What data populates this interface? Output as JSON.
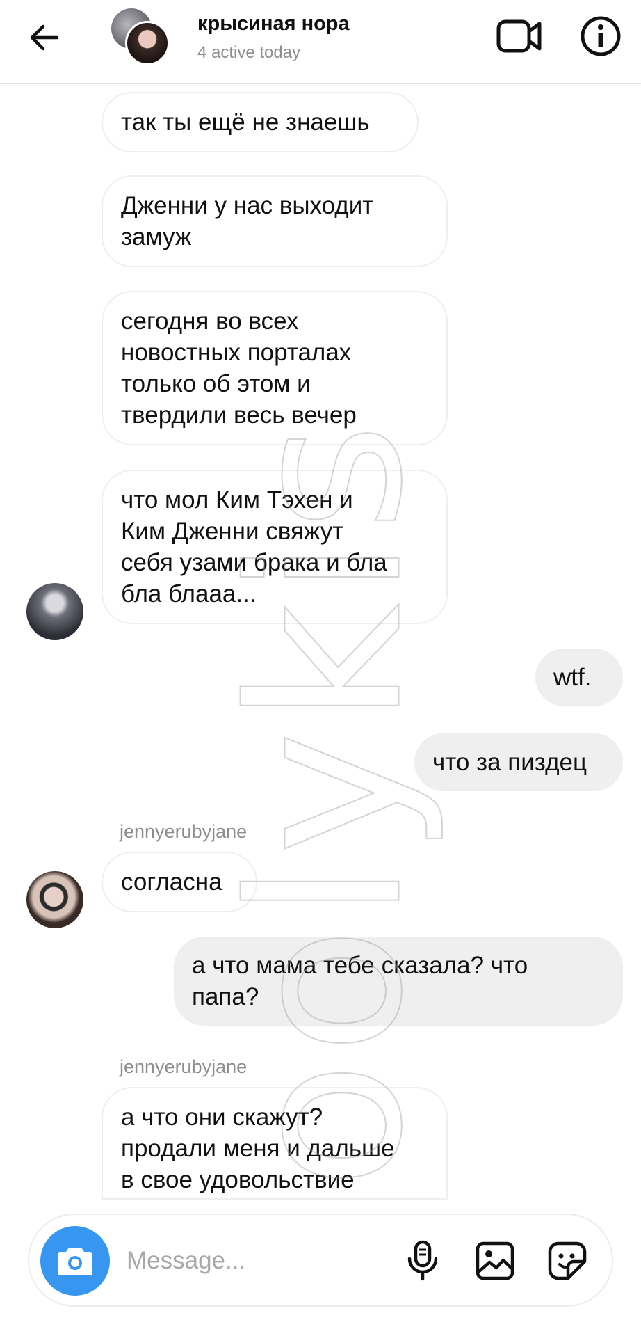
{
  "header": {
    "title": "крысиная нора",
    "status": "4 active today"
  },
  "messages": [
    {
      "direction": "in",
      "text": "так ты ещё не знаешь"
    },
    {
      "direction": "in",
      "text": "Дженни у нас выходит\nзамуж"
    },
    {
      "direction": "in",
      "text": "сегодня во всех\nновостных порталах\nтолько об этом и\nтвердили весь вечер"
    },
    {
      "direction": "in",
      "text": "что мол Ким Тэхен и\nКим Дженни свяжут\nсебя узами брака и бла\nбла блааа..."
    },
    {
      "direction": "out",
      "text": "wtf."
    },
    {
      "direction": "out",
      "text": "что за пиздец"
    },
    {
      "direction": "in",
      "sender": "jennyerubyjane",
      "text": "согласна"
    },
    {
      "direction": "out",
      "text": "а что мама тебе сказала? что\nпапа?"
    },
    {
      "direction": "in",
      "sender": "jennyerubyjane",
      "text": "а что они скажут?\nпродали меня и дальше\nв свое удовольствие"
    }
  ],
  "watermark": "loolykis",
  "composer": {
    "placeholder": "Message..."
  },
  "colors": {
    "accent": "#3797f0",
    "outgoing_bubble": "#efefef",
    "secondary_text": "#8e8e8e"
  },
  "icons": {
    "back": "arrow-left-icon",
    "video": "video-camera-icon",
    "info": "info-icon",
    "camera": "camera-icon",
    "mic": "microphone-icon",
    "gallery": "image-icon",
    "sticker": "sticker-icon"
  }
}
